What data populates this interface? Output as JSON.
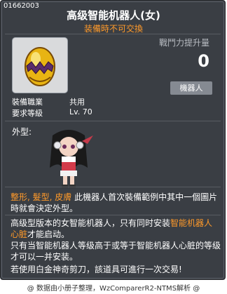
{
  "item_id": "01662003",
  "title": "高级智能机器人(女)",
  "subtitle": "装備時不可交換",
  "power": {
    "label": "戰鬥力提升量",
    "value": "0"
  },
  "category": "機器人",
  "requirements": [
    {
      "label": "裝備職業",
      "value": "共用"
    },
    {
      "label": "要求等級",
      "value": "Lv. 70"
    }
  ],
  "appearance_label": "外型:",
  "notice": {
    "part1": "整形, 髮型, 皮膚",
    "part2": "此機器人首次裝備範例中其中一個圖片時就會決定外型。"
  },
  "desc_line1_a": "高级型版本的女智能机器人，只有同时安装",
  "desc_line1_b": "智能机器人心脏",
  "desc_line1_c": "才能启动。",
  "desc_line2": "只有当智能机器人等级高于或等于智能机器人心脏的等级才可以一并安装。",
  "scissors_note": "若使用白金神奇剪刀，該道具可進行一次交易!",
  "footer": "@ 数据由小册子整理，WzComparerR2-NTMS解析 @",
  "colors": {
    "background": "#3a3e44",
    "accent": "#ff9a2a",
    "text": "#ffffff"
  }
}
